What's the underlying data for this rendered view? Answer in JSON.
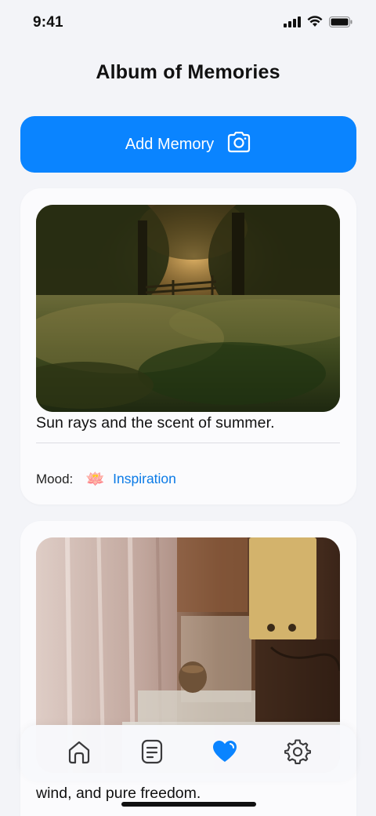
{
  "status_bar": {
    "time": "9:41"
  },
  "page": {
    "title": "Album of Memories"
  },
  "add_button": {
    "label": "Add Memory",
    "icon": "camera-icon"
  },
  "memories": [
    {
      "caption": "Sun rays and the scent of summer.",
      "mood_label": "Mood:",
      "mood_emoji": "🪷",
      "mood_value": "Inspiration"
    },
    {
      "caption": "wind, and pure freedom."
    }
  ],
  "tab_bar": {
    "tabs": [
      {
        "icon": "home-icon",
        "active": false
      },
      {
        "icon": "notes-icon",
        "active": false
      },
      {
        "icon": "heart-icon",
        "active": true
      },
      {
        "icon": "gear-icon",
        "active": false
      }
    ]
  },
  "colors": {
    "accent": "#0a84ff",
    "background": "#f3f4f8",
    "mood_text": "#0a7ae6"
  }
}
